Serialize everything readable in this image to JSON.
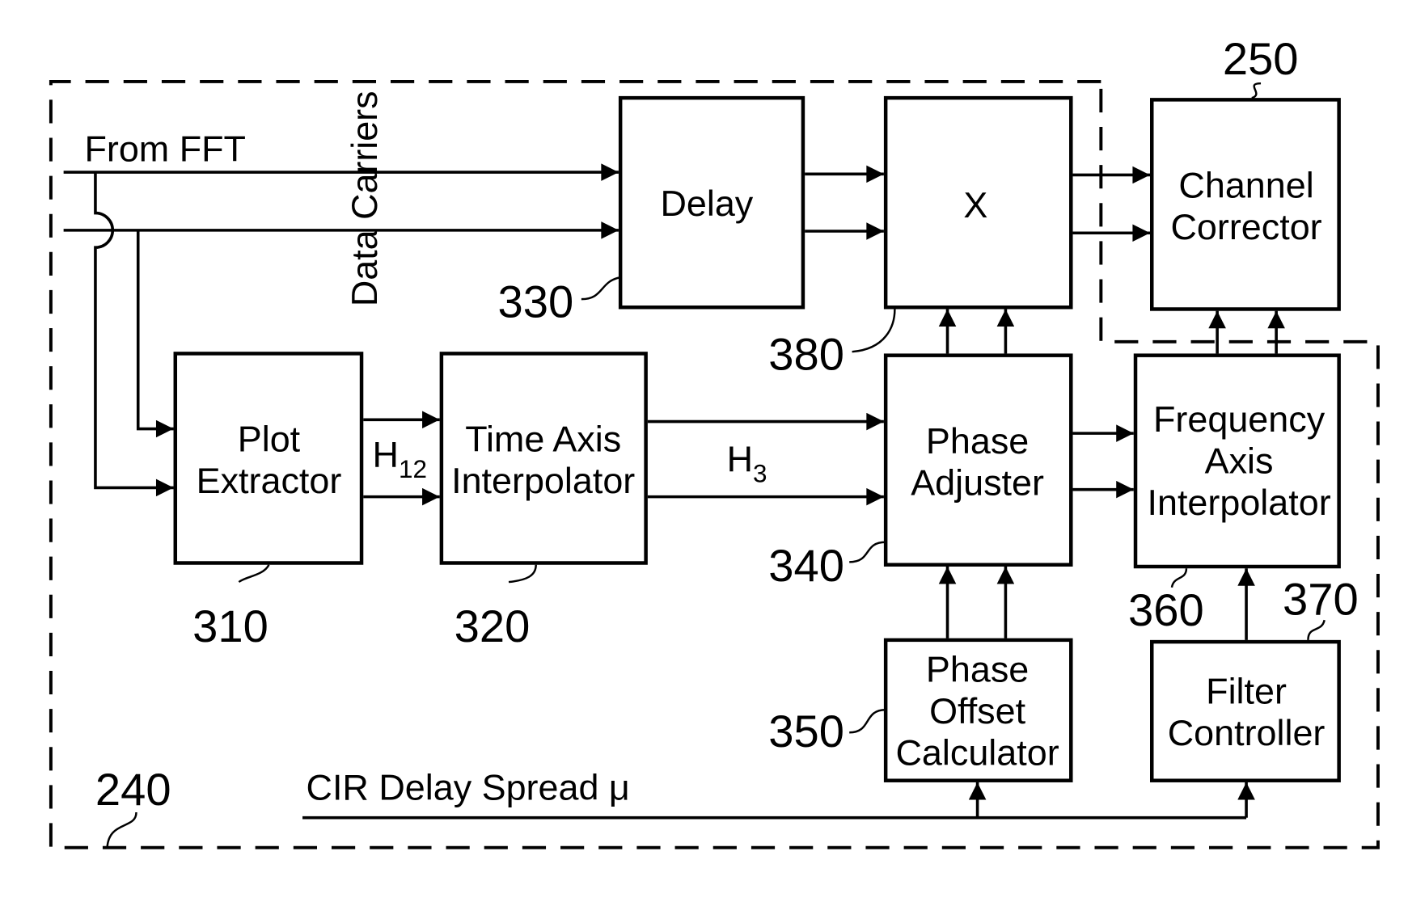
{
  "diagram": {
    "type": "block-diagram",
    "reference_labels": {
      "outer_block": "240",
      "channel_corrector": "250",
      "plot_extractor": "310",
      "time_axis_interpolator": "320",
      "delay": "330",
      "phase_adjuster": "340",
      "phase_offset_calculator": "350",
      "frequency_axis_interpolator": "360",
      "filter_controller": "370",
      "multiplier": "380"
    },
    "blocks": {
      "delay": [
        "Delay"
      ],
      "multiplier": [
        "X"
      ],
      "channel_corrector": [
        "Channel",
        "Corrector"
      ],
      "plot_extractor": [
        "Plot",
        "Extractor"
      ],
      "time_axis_interpolator": [
        "Time Axis",
        "Interpolator"
      ],
      "phase_adjuster": [
        "Phase",
        "Adjuster"
      ],
      "frequency_axis_interpolator": [
        "Frequency",
        "Axis",
        "Interpolator"
      ],
      "phase_offset_calculator": [
        "Phase",
        "Offset",
        "Calculator"
      ],
      "filter_controller": [
        "Filter",
        "Controller"
      ]
    },
    "signals": {
      "from_fft": "From FFT",
      "data_carriers": "Data Carriers",
      "h12_base": "H",
      "h12_sub": "12",
      "h3_base": "H",
      "h3_sub": "3",
      "cir_delay_spread": "CIR Delay Spread μ"
    }
  }
}
